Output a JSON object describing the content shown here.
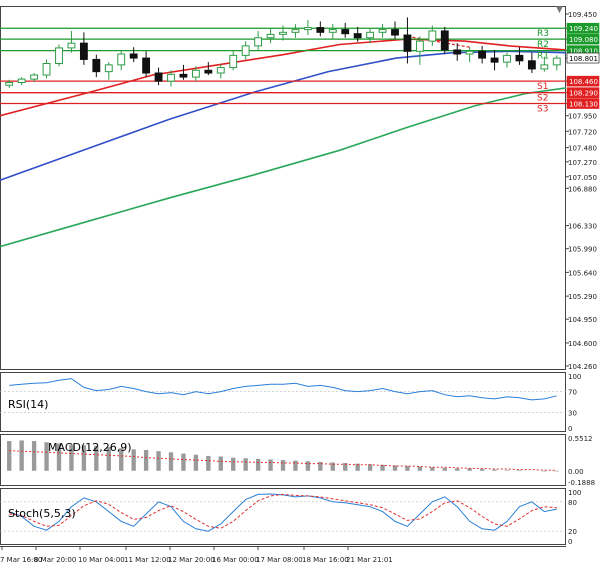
{
  "chart_data": {
    "type": "candlestick",
    "scroll_marker": "▼",
    "colors": {
      "up_candle": "#2e9b45",
      "down_candle": "#111111",
      "ma_fast": "#e02020",
      "ma_mid": "#3050c8",
      "ma_slow": "#2aa85a",
      "resistance": "#1a9a2a",
      "support": "#e02020",
      "indicator": "#2a7fd8",
      "signal": "#e03030",
      "frame": "#444444"
    },
    "price_axis": {
      "ticks": [
        "109.450",
        "109.240",
        "109.080",
        "108.910",
        "108.801",
        "108.460",
        "108.290",
        "108.130",
        "107.950",
        "107.720",
        "107.480",
        "107.270",
        "107.050",
        "106.880",
        "106.330",
        "105.990",
        "105.640",
        "105.290",
        "104.950",
        "104.600",
        "104.260"
      ],
      "min": 104.26,
      "max": 109.45
    },
    "levels": [
      {
        "name": "R3",
        "value": 109.24,
        "label": "109.240",
        "kind": "resistance"
      },
      {
        "name": "R2",
        "value": 109.08,
        "label": "109.080",
        "kind": "resistance"
      },
      {
        "name": "R1",
        "value": 108.91,
        "label": "108.910",
        "kind": "resistance"
      },
      {
        "name": "",
        "value": 108.801,
        "label": "108.801",
        "kind": "current"
      },
      {
        "name": "S1",
        "value": 108.46,
        "label": "108.460",
        "kind": "support"
      },
      {
        "name": "S2",
        "value": 108.29,
        "label": "108.290",
        "kind": "support"
      },
      {
        "name": "S3",
        "value": 108.13,
        "label": "108.130",
        "kind": "support"
      }
    ],
    "x_labels": [
      "7 Mar 16:00",
      "8 Mar 20:00",
      "10 Mar 04:00",
      "11 Mar 12:00",
      "12 Mar 20:00",
      "16 Mar 00:00",
      "17 Mar 08:00",
      "18 Mar 16:00",
      "21 Mar 21:01"
    ],
    "candles": [
      [
        108.4,
        108.48,
        108.36,
        108.44
      ],
      [
        108.44,
        108.52,
        108.4,
        108.49
      ],
      [
        108.49,
        108.58,
        108.45,
        108.55
      ],
      [
        108.55,
        108.78,
        108.5,
        108.72
      ],
      [
        108.72,
        109.0,
        108.68,
        108.95
      ],
      [
        108.95,
        109.2,
        108.88,
        109.02
      ],
      [
        109.02,
        109.18,
        108.7,
        108.78
      ],
      [
        108.78,
        108.85,
        108.52,
        108.6
      ],
      [
        108.6,
        108.74,
        108.48,
        108.7
      ],
      [
        108.7,
        108.92,
        108.62,
        108.86
      ],
      [
        108.86,
        108.96,
        108.74,
        108.8
      ],
      [
        108.8,
        108.9,
        108.52,
        108.58
      ],
      [
        108.58,
        108.66,
        108.4,
        108.46
      ],
      [
        108.46,
        108.62,
        108.38,
        108.56
      ],
      [
        108.56,
        108.7,
        108.48,
        108.52
      ],
      [
        108.52,
        108.68,
        108.46,
        108.62
      ],
      [
        108.62,
        108.74,
        108.55,
        108.58
      ],
      [
        108.58,
        108.7,
        108.5,
        108.66
      ],
      [
        108.66,
        108.9,
        108.62,
        108.84
      ],
      [
        108.84,
        109.05,
        108.78,
        108.98
      ],
      [
        108.98,
        109.2,
        108.92,
        109.1
      ],
      [
        109.1,
        109.24,
        109.02,
        109.15
      ],
      [
        109.15,
        109.28,
        109.06,
        109.18
      ],
      [
        109.18,
        109.3,
        109.1,
        109.22
      ],
      [
        109.22,
        109.36,
        109.14,
        109.25
      ],
      [
        109.25,
        109.34,
        109.12,
        109.18
      ],
      [
        109.18,
        109.3,
        109.08,
        109.22
      ],
      [
        109.22,
        109.32,
        109.1,
        109.16
      ],
      [
        109.16,
        109.26,
        109.04,
        109.1
      ],
      [
        109.1,
        109.24,
        109.02,
        109.18
      ],
      [
        109.18,
        109.3,
        109.1,
        109.22
      ],
      [
        109.22,
        109.34,
        109.08,
        109.14
      ],
      [
        109.14,
        109.4,
        108.72,
        108.9
      ],
      [
        108.9,
        109.12,
        108.7,
        109.05
      ],
      [
        109.05,
        109.28,
        108.98,
        109.2
      ],
      [
        109.2,
        109.26,
        108.86,
        108.92
      ],
      [
        108.92,
        109.02,
        108.76,
        108.86
      ],
      [
        108.86,
        108.96,
        108.74,
        108.9
      ],
      [
        108.9,
        108.98,
        108.72,
        108.8
      ],
      [
        108.8,
        108.92,
        108.62,
        108.74
      ],
      [
        108.74,
        108.88,
        108.66,
        108.84
      ],
      [
        108.84,
        108.96,
        108.7,
        108.76
      ],
      [
        108.76,
        108.88,
        108.58,
        108.64
      ],
      [
        108.64,
        108.82,
        108.6,
        108.7
      ],
      [
        108.7,
        108.84,
        108.62,
        108.8
      ]
    ],
    "ma_fast": [
      [
        0,
        107.95
      ],
      [
        0.16,
        108.3
      ],
      [
        0.27,
        108.55
      ],
      [
        0.37,
        108.68
      ],
      [
        0.5,
        108.85
      ],
      [
        0.6,
        109.0
      ],
      [
        0.72,
        109.08
      ],
      [
        0.82,
        109.05
      ],
      [
        0.9,
        108.98
      ],
      [
        1,
        108.92
      ]
    ],
    "ma_mid": [
      [
        0,
        107.0
      ],
      [
        0.15,
        107.45
      ],
      [
        0.3,
        107.9
      ],
      [
        0.45,
        108.3
      ],
      [
        0.58,
        108.6
      ],
      [
        0.7,
        108.8
      ],
      [
        0.8,
        108.88
      ],
      [
        0.9,
        108.9
      ],
      [
        1,
        108.88
      ]
    ],
    "ma_slow": [
      [
        0,
        106.02
      ],
      [
        0.15,
        106.38
      ],
      [
        0.3,
        106.74
      ],
      [
        0.45,
        107.08
      ],
      [
        0.6,
        107.44
      ],
      [
        0.72,
        107.78
      ],
      [
        0.84,
        108.1
      ],
      [
        0.93,
        108.28
      ],
      [
        1,
        108.36
      ]
    ],
    "trend_line": [
      [
        0.72,
        109.12
      ],
      [
        0.83,
        108.96
      ]
    ],
    "rsi": {
      "label": "RSI(14)",
      "ticks": [
        "100",
        "70",
        "30",
        "0"
      ],
      "values": [
        82,
        84,
        86,
        87,
        92,
        95,
        78,
        72,
        74,
        80,
        76,
        70,
        66,
        68,
        64,
        70,
        66,
        70,
        76,
        80,
        82,
        84,
        84,
        86,
        80,
        82,
        78,
        72,
        70,
        72,
        76,
        70,
        66,
        70,
        72,
        64,
        60,
        62,
        58,
        56,
        60,
        58,
        54,
        56,
        62
      ]
    },
    "macd": {
      "label": "MACD(12,26,9)",
      "ticks": [
        "0.5512",
        "0.00",
        "-0.1888"
      ],
      "max": 0.5512,
      "min": -0.1888,
      "bars": [
        0.5,
        0.51,
        0.5,
        0.48,
        0.46,
        0.44,
        0.43,
        0.42,
        0.4,
        0.38,
        0.36,
        0.35,
        0.33,
        0.31,
        0.29,
        0.27,
        0.25,
        0.24,
        0.22,
        0.21,
        0.2,
        0.19,
        0.18,
        0.17,
        0.16,
        0.15,
        0.14,
        0.13,
        0.12,
        0.11,
        0.1,
        0.09,
        0.08,
        0.07,
        0.06,
        0.05,
        0.04,
        0.04,
        0.03,
        0.02,
        0.01,
        0.01,
        0.0,
        -0.01,
        -0.01
      ],
      "signal": [
        0.34,
        0.33,
        0.32,
        0.31,
        0.3,
        0.29,
        0.28,
        0.27,
        0.26,
        0.25,
        0.24,
        0.22,
        0.21,
        0.2,
        0.19,
        0.18,
        0.17,
        0.16,
        0.15,
        0.15,
        0.14,
        0.14,
        0.13,
        0.13,
        0.12,
        0.12,
        0.11,
        0.11,
        0.1,
        0.1,
        0.09,
        0.08,
        0.08,
        0.07,
        0.06,
        0.06,
        0.05,
        0.04,
        0.04,
        0.03,
        0.03,
        0.02,
        0.02,
        0.01,
        0.01
      ]
    },
    "stoch": {
      "label": "Stoch(5,5,3)",
      "ticks": [
        "100",
        "80",
        "20",
        "0"
      ],
      "k": [
        60,
        50,
        30,
        22,
        40,
        70,
        88,
        80,
        60,
        40,
        30,
        55,
        80,
        70,
        40,
        25,
        20,
        35,
        60,
        85,
        95,
        96,
        94,
        90,
        92,
        88,
        80,
        78,
        74,
        70,
        60,
        40,
        30,
        55,
        80,
        90,
        70,
        40,
        25,
        22,
        40,
        70,
        80,
        60,
        65
      ],
      "d": [
        55,
        52,
        40,
        30,
        32,
        52,
        72,
        82,
        75,
        58,
        44,
        48,
        62,
        72,
        60,
        44,
        30,
        26,
        40,
        62,
        82,
        92,
        95,
        93,
        92,
        90,
        86,
        82,
        78,
        74,
        68,
        55,
        42,
        45,
        60,
        78,
        82,
        68,
        50,
        35,
        30,
        45,
        62,
        70,
        68
      ]
    }
  }
}
